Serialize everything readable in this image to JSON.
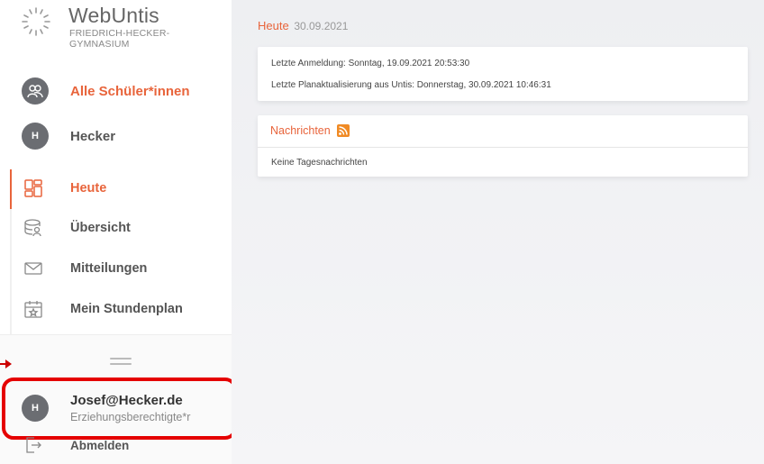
{
  "brand": {
    "title": "WebUntis",
    "school_line1": "FRIEDRICH-HECKER-",
    "school_line2": "GYMNASIUM"
  },
  "profiles": [
    {
      "label": "Alle Schüler*innen",
      "icon": "students-icon",
      "active": true
    },
    {
      "label": "Hecker",
      "avatar_letter": "H",
      "active": false
    }
  ],
  "nav": [
    {
      "label": "Heute",
      "icon": "dashboard-icon",
      "active": true
    },
    {
      "label": "Übersicht",
      "icon": "overview-icon",
      "active": false
    },
    {
      "label": "Mitteilungen",
      "icon": "envelope-icon",
      "active": false
    },
    {
      "label": "Mein Stundenplan",
      "icon": "calendar-icon",
      "active": false
    }
  ],
  "user": {
    "avatar_letter": "H",
    "email": "Josef@Hecker.de",
    "role": "Erziehungsberechtigte*r"
  },
  "logout_label": "Abmelden",
  "main": {
    "heading": "Heute",
    "date": "30.09.2021",
    "login_info": {
      "last_login": "Letzte Anmeldung: Sonntag, 19.09.2021 20:53:30",
      "last_update": "Letzte Planaktualisierung aus Untis: Donnerstag, 30.09.2021 10:46:31"
    },
    "news": {
      "title": "Nachrichten",
      "empty_text": "Keine Tagesnachrichten"
    }
  },
  "colors": {
    "accent": "#e8643b",
    "highlight_border": "#e50000",
    "avatar_bg": "#6b6d72"
  }
}
